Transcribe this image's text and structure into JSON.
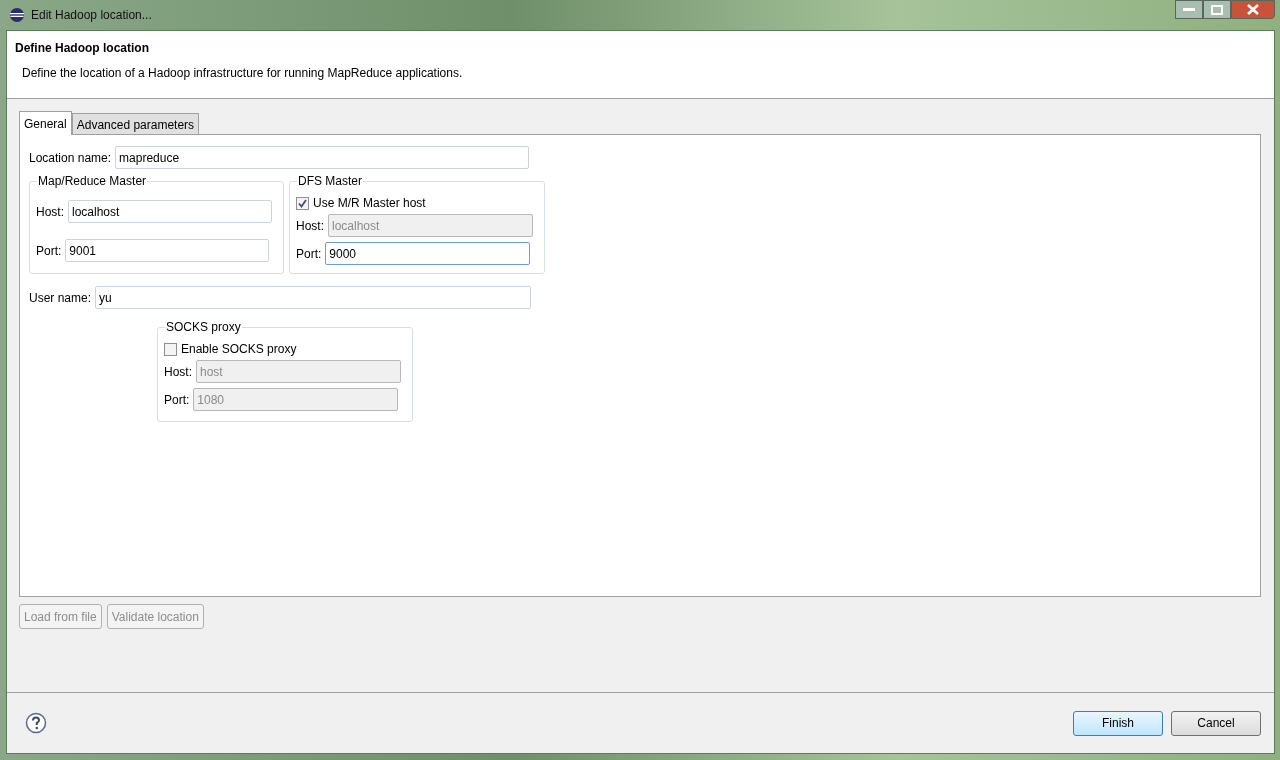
{
  "window": {
    "title": "Edit Hadoop location..."
  },
  "header": {
    "title": "Define Hadoop location",
    "description": "Define the location of a Hadoop infrastructure for running MapReduce applications."
  },
  "tabs": [
    {
      "label": "General",
      "selected": true
    },
    {
      "label": "Advanced parameters",
      "selected": false
    }
  ],
  "location_name": {
    "label": "Location name:",
    "value": "mapreduce",
    "disabled": false,
    "focused": false
  },
  "mr_master": {
    "title": "Map/Reduce Master",
    "host": {
      "label": "Host:",
      "value": "localhost",
      "disabled": false,
      "focused": false
    },
    "port": {
      "label": "Port:",
      "value": "9001",
      "disabled": false,
      "focused": false
    }
  },
  "dfs_master": {
    "title": "DFS Master",
    "use_mr_host": {
      "label": "Use M/R Master host",
      "checked": true
    },
    "host": {
      "label": "Host:",
      "value": "localhost",
      "disabled": true,
      "focused": false
    },
    "port": {
      "label": "Port:",
      "value": "9000",
      "disabled": false,
      "focused": true
    }
  },
  "user_name": {
    "label": "User name:",
    "value": "yu",
    "disabled": false,
    "focused": false
  },
  "socks_proxy": {
    "title": "SOCKS proxy",
    "enable": {
      "label": "Enable SOCKS proxy",
      "checked": false
    },
    "host": {
      "label": "Host:",
      "value": "host",
      "disabled": true,
      "focused": false
    },
    "port": {
      "label": "Port:",
      "value": "1080",
      "disabled": true,
      "focused": false
    }
  },
  "panel_buttons": [
    {
      "label": "Load from file",
      "disabled": true
    },
    {
      "label": "Validate location",
      "disabled": true
    }
  ],
  "footer_buttons": [
    {
      "label": "Finish",
      "default": true
    },
    {
      "label": "Cancel",
      "default": false
    }
  ]
}
